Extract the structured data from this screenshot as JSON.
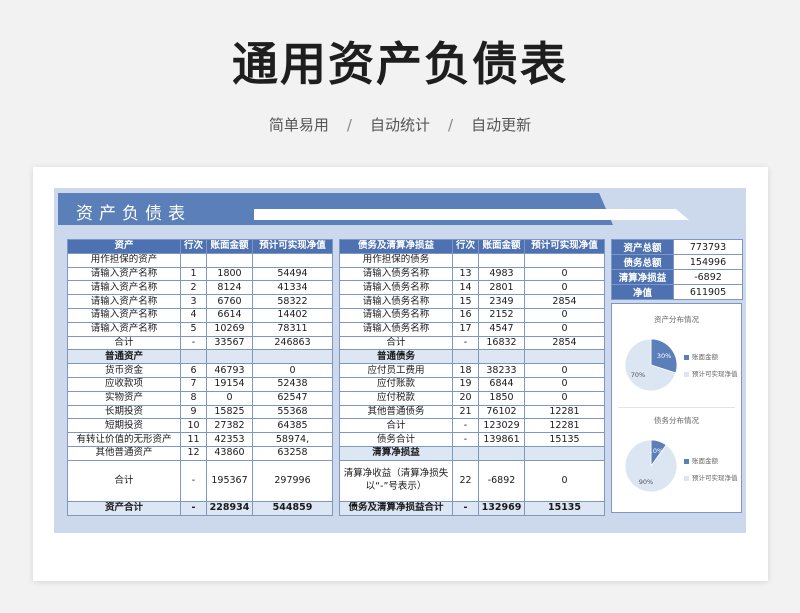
{
  "header": {
    "title": "通用资产负债表",
    "features": [
      "简单易用",
      "自动统计",
      "自动更新"
    ],
    "separator": "/"
  },
  "sheet": {
    "title": "资产负债表"
  },
  "left_table": {
    "headers": [
      "资产",
      "行次",
      "账面金额",
      "预计可实现净值"
    ],
    "rows": [
      {
        "cls": "",
        "cells": [
          "用作担保的资产",
          "",
          "",
          ""
        ]
      },
      {
        "cls": "",
        "cells": [
          "请输入资产名称",
          "1",
          "1800",
          "54494"
        ]
      },
      {
        "cls": "",
        "cells": [
          "请输入资产名称",
          "2",
          "8124",
          "41334"
        ]
      },
      {
        "cls": "",
        "cells": [
          "请输入资产名称",
          "3",
          "6760",
          "58322"
        ]
      },
      {
        "cls": "",
        "cells": [
          "请输入资产名称",
          "4",
          "6614",
          "14402"
        ]
      },
      {
        "cls": "",
        "cells": [
          "请输入资产名称",
          "5",
          "10269",
          "78311"
        ]
      },
      {
        "cls": "",
        "cells": [
          "合计",
          "-",
          "33567",
          "246863"
        ]
      },
      {
        "cls": "sec",
        "cells": [
          "普通资产",
          "",
          "",
          ""
        ]
      },
      {
        "cls": "",
        "cells": [
          "货币资金",
          "6",
          "46793",
          "0"
        ]
      },
      {
        "cls": "",
        "cells": [
          "应收款项",
          "7",
          "19154",
          "52438"
        ]
      },
      {
        "cls": "",
        "cells": [
          "实物资产",
          "8",
          "0",
          "62547"
        ]
      },
      {
        "cls": "",
        "cells": [
          "长期投资",
          "9",
          "15825",
          "55368"
        ]
      },
      {
        "cls": "",
        "cells": [
          "短期投资",
          "10",
          "27382",
          "64385"
        ]
      },
      {
        "cls": "",
        "cells": [
          "有转让价值的无形资产",
          "11",
          "42353",
          "58974,"
        ]
      },
      {
        "cls": "",
        "cells": [
          "其他普通资产",
          "12",
          "43860",
          "63258"
        ]
      },
      {
        "cls": "tall",
        "cells": [
          "合计",
          "-",
          "195367",
          "297996"
        ]
      },
      {
        "cls": "total",
        "cells": [
          "资产合计",
          "-",
          "228934",
          "544859"
        ]
      }
    ]
  },
  "right_table": {
    "headers": [
      "债务及清算净损益",
      "行次",
      "账面金额",
      "预计可实现净值"
    ],
    "rows": [
      {
        "cls": "",
        "cells": [
          "用作担保的债务",
          "",
          "",
          ""
        ]
      },
      {
        "cls": "",
        "cells": [
          "请输入债务名称",
          "13",
          "4983",
          "0"
        ]
      },
      {
        "cls": "",
        "cells": [
          "请输入债务名称",
          "14",
          "2801",
          "0"
        ]
      },
      {
        "cls": "",
        "cells": [
          "请输入债务名称",
          "15",
          "2349",
          "2854"
        ]
      },
      {
        "cls": "",
        "cells": [
          "请输入债务名称",
          "16",
          "2152",
          "0"
        ]
      },
      {
        "cls": "",
        "cells": [
          "请输入债务名称",
          "17",
          "4547",
          "0"
        ]
      },
      {
        "cls": "",
        "cells": [
          "合计",
          "-",
          "16832",
          "2854"
        ]
      },
      {
        "cls": "sec",
        "cells": [
          "普通债务",
          "",
          "",
          ""
        ]
      },
      {
        "cls": "",
        "cells": [
          "应付员工费用",
          "18",
          "38233",
          "0"
        ]
      },
      {
        "cls": "",
        "cells": [
          "应付账款",
          "19",
          "6844",
          "0"
        ]
      },
      {
        "cls": "",
        "cells": [
          "应付税款",
          "20",
          "1850",
          "0"
        ]
      },
      {
        "cls": "",
        "cells": [
          "其他普通债务",
          "21",
          "76102",
          "12281"
        ]
      },
      {
        "cls": "",
        "cells": [
          "合计",
          "-",
          "123029",
          "12281"
        ]
      },
      {
        "cls": "",
        "cells": [
          "债务合计",
          "-",
          "139861",
          "15135"
        ]
      },
      {
        "cls": "sec",
        "cells": [
          "清算净损益",
          "",
          "",
          ""
        ]
      },
      {
        "cls": "tall",
        "cells": [
          "清算净收益（清算净损失以“-”号表示）",
          "22",
          "-6892",
          "0"
        ]
      },
      {
        "cls": "total",
        "cells": [
          "债务及清算净损益合计",
          "-",
          "132969",
          "15135"
        ]
      }
    ]
  },
  "summary": [
    {
      "label": "资产总额",
      "value": "773793"
    },
    {
      "label": "债务总额",
      "value": "154996"
    },
    {
      "label": "清算净损益",
      "value": "-6892"
    },
    {
      "label": "净值",
      "value": "611905"
    }
  ],
  "colors": {
    "primary": "#4e72b1",
    "banner": "#5b7fb8",
    "pie_main": "#5b7fb8",
    "pie_light": "#dce5f2"
  },
  "chart_data": [
    {
      "type": "pie",
      "title": "资产分布情况",
      "categories": [
        "账面金额",
        "预计可实现净值"
      ],
      "values": [
        30,
        70
      ],
      "labels": [
        "30%",
        "70%"
      ]
    },
    {
      "type": "pie",
      "title": "债务分布情况",
      "categories": [
        "账面金额",
        "预计可实现净值"
      ],
      "values": [
        10,
        90
      ],
      "labels": [
        "10%",
        "90%"
      ]
    }
  ]
}
